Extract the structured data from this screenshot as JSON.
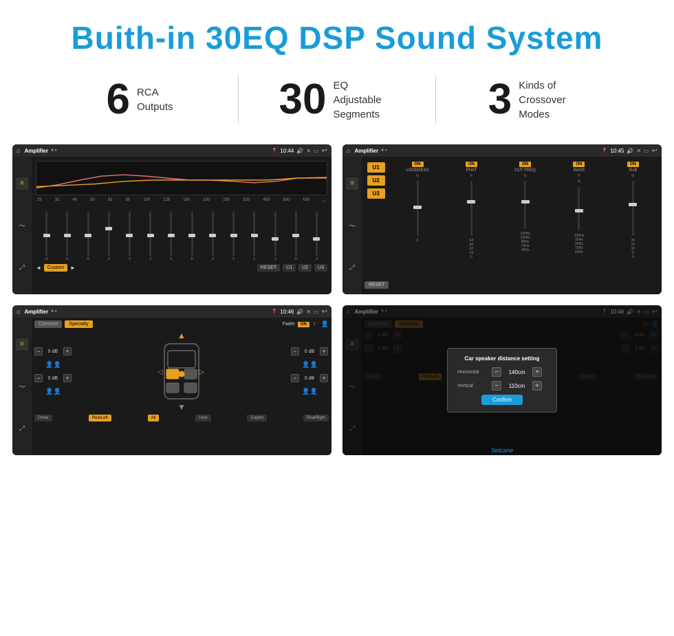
{
  "header": {
    "title": "Buith-in 30EQ DSP Sound System"
  },
  "stats": [
    {
      "number": "6",
      "label": "RCA\nOutputs"
    },
    {
      "number": "30",
      "label": "EQ Adjustable\nSegments"
    },
    {
      "number": "3",
      "label": "Kinds of\nCrossover Modes"
    }
  ],
  "screens": {
    "eq": {
      "topbar": {
        "title": "Amplifier",
        "time": "10:44"
      },
      "freq_labels": [
        "25",
        "32",
        "40",
        "50",
        "63",
        "80",
        "100",
        "125",
        "160",
        "200",
        "250",
        "320",
        "400",
        "500",
        "630"
      ],
      "sliders": [
        0,
        0,
        0,
        5,
        0,
        0,
        0,
        0,
        0,
        0,
        0,
        -1,
        0,
        -1
      ],
      "bottom_btns": [
        "Custom",
        "RESET",
        "U1",
        "U2",
        "U3"
      ]
    },
    "amp": {
      "topbar": {
        "title": "Amplifier",
        "time": "10:45"
      },
      "u_buttons": [
        "U1",
        "U2",
        "U3"
      ],
      "controls": [
        {
          "label": "LOUDNESS",
          "on": true
        },
        {
          "label": "PHAT",
          "on": true
        },
        {
          "label": "CUT FREQ",
          "on": true
        },
        {
          "label": "BASS",
          "on": true
        },
        {
          "label": "SUB",
          "on": true
        }
      ],
      "reset_label": "RESET"
    },
    "fader": {
      "topbar": {
        "title": "Amplifier",
        "time": "10:46"
      },
      "tabs": [
        "Common",
        "Specialty"
      ],
      "fader_label": "Fader",
      "on_label": "ON",
      "channels": [
        {
          "label": "0 dB"
        },
        {
          "label": "0 dB"
        },
        {
          "label": "0 dB"
        },
        {
          "label": "0 dB"
        }
      ],
      "btn_labels": [
        "Driver",
        "RearLeft",
        "All",
        "User",
        "Copilot",
        "RearRight"
      ]
    },
    "distance": {
      "topbar": {
        "title": "Amplifier",
        "time": "10:46"
      },
      "tabs": [
        "Common",
        "Specialty"
      ],
      "dialog": {
        "title": "Car speaker distance setting",
        "horizontal_label": "Horizontal",
        "horizontal_value": "140cm",
        "vertical_label": "Vertical",
        "vertical_value": "110cm",
        "confirm_label": "Confirm"
      },
      "channels": [
        {
          "label": "0 dB"
        },
        {
          "label": "0 dB"
        }
      ],
      "btn_labels": [
        "Driver",
        "RearLeft",
        "All",
        "User",
        "Copilot",
        "RearRight"
      ]
    }
  },
  "watermark": "Seicane"
}
